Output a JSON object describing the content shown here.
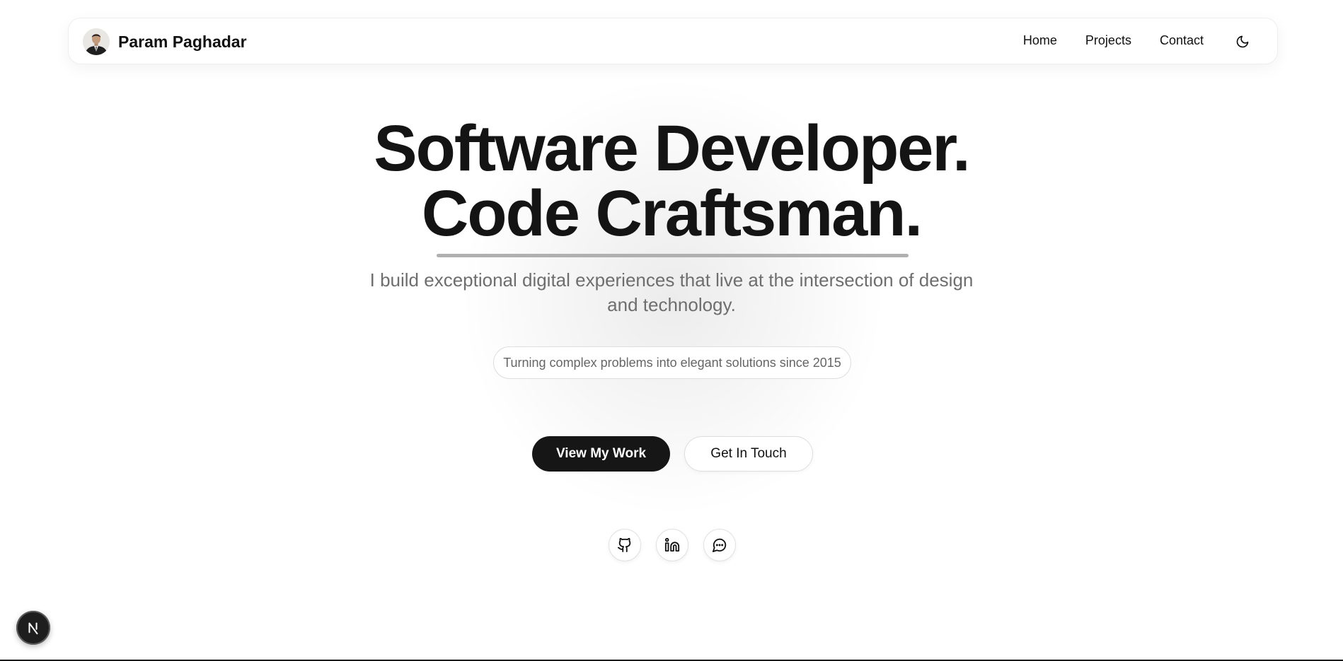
{
  "header": {
    "name": "Param Paghadar",
    "nav": [
      {
        "label": "Home"
      },
      {
        "label": "Projects"
      },
      {
        "label": "Contact"
      }
    ],
    "theme_toggle_icon": "moon-icon"
  },
  "hero": {
    "headline_line1": "Software Developer.",
    "headline_line2": "Code Craftsman.",
    "subtitle": "I build exceptional digital experiences that live at the intersection of design and technology.",
    "tagline": "Turning complex problems into elegant solutions since 2015",
    "primary_button": "View My Work",
    "secondary_button": "Get In Touch"
  },
  "social": [
    {
      "icon": "github-icon"
    },
    {
      "icon": "linkedin-icon"
    },
    {
      "icon": "chat-icon"
    }
  ],
  "dev_badge_icon": "nextjs-n-icon",
  "colors": {
    "text": "#111111",
    "muted": "#6e6e6e",
    "primary_button_bg": "#161616",
    "background": "#ffffff"
  }
}
